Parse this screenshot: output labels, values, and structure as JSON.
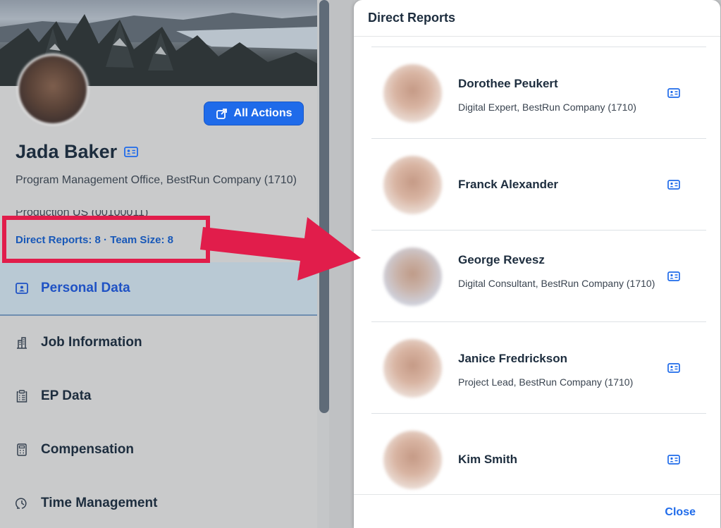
{
  "profile": {
    "name": "Jada Baker",
    "subtitle": "Program Management Office, BestRun Company (1710)",
    "partial_line": "Production US (00100011)",
    "reports_link": "Direct Reports: 8 · Team Size: 8",
    "actions_label": "All Actions"
  },
  "nav": [
    {
      "label": "Personal Data",
      "icon": "contact-card-icon",
      "active": true
    },
    {
      "label": "Job Information",
      "icon": "building-icon",
      "active": false
    },
    {
      "label": "EP Data",
      "icon": "clipboard-list-icon",
      "active": false
    },
    {
      "label": "Compensation",
      "icon": "calculator-icon",
      "active": false
    },
    {
      "label": "Time Management",
      "icon": "clock-icon",
      "active": false
    }
  ],
  "dialog": {
    "title": "Direct Reports",
    "close_label": "Close",
    "reports": [
      {
        "name": "Dorothee Peukert",
        "title": "Digital Expert, BestRun Company (1710)"
      },
      {
        "name": "Franck Alexander",
        "title": ""
      },
      {
        "name": "George Revesz",
        "title": "Digital Consultant, BestRun Company (1710)"
      },
      {
        "name": "Janice Fredrickson",
        "title": "Project Lead, BestRun Company (1710)"
      },
      {
        "name": "Kim Smith",
        "title": ""
      }
    ]
  },
  "colors": {
    "accent": "#1f6bea",
    "highlight": "#e11d4b",
    "link": "#1858b8"
  }
}
